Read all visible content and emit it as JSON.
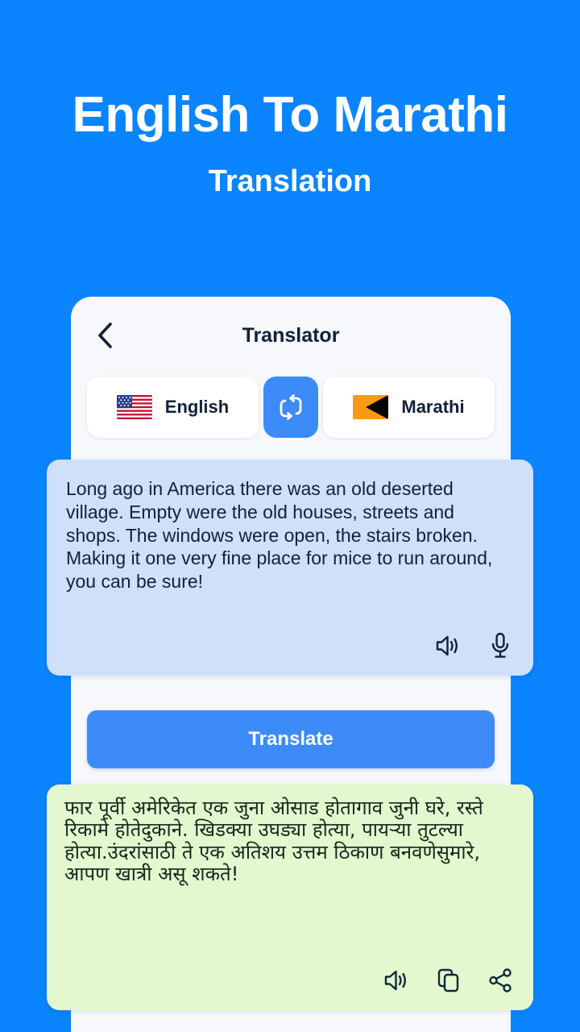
{
  "promo": {
    "title": "English To Marathi",
    "subtitle": "Translation"
  },
  "app": {
    "bar": {
      "title": "Translator",
      "back_icon": "chevron-left-icon"
    },
    "languages": {
      "source": {
        "label": "English",
        "flag": "us-flag-icon"
      },
      "target": {
        "label": "Marathi",
        "flag": "marathi-flag-icon"
      },
      "swap_icon": "swap-repeat-icon"
    },
    "input_panel": {
      "text": "Long ago in America there was an old deserted village. Empty were the old houses, streets and shops. The windows were open, the stairs broken. Making it one very fine place for mice to run around, you can be sure!",
      "actions": [
        "speaker-icon",
        "microphone-icon"
      ]
    },
    "translate_button": {
      "label": "Translate"
    },
    "output_panel": {
      "text": "फार पूर्वी अमेरिकेत एक जुना ओसाड होतागाव जुनी घरे, रस्ते रिकामे होतेदुकाने. खिडक्या उघड्या होत्या, पायऱ्या तुटल्या होत्या.उंदरांसाठी ते एक अतिशय उत्तम ठिकाण बनवणेसुमारे, आपण खात्री असू शकते!",
      "actions": [
        "speaker-icon",
        "copy-icon",
        "share-icon"
      ]
    }
  },
  "colors": {
    "background_blue": "#0a84ff",
    "accent_blue": "#3d8bf8",
    "card_bg": "#f6f8fb",
    "input_panel_bg": "#cfe0fb",
    "output_panel_bg": "#e4f8cf",
    "text_dark": "#10213a"
  }
}
